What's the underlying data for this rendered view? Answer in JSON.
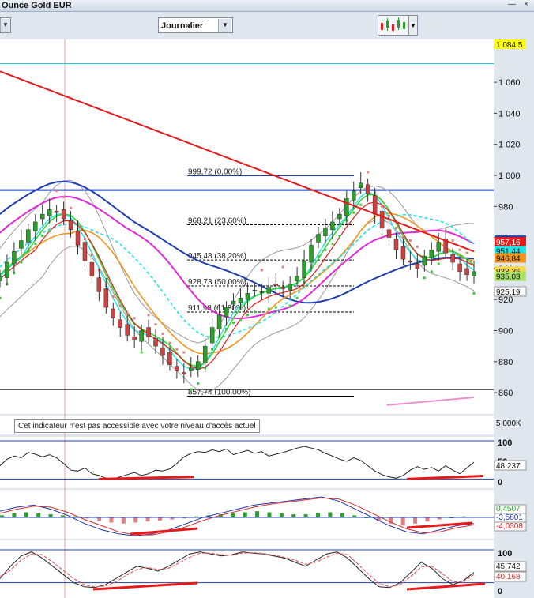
{
  "window": {
    "title": "Ounce Gold EUR",
    "minimize": "—",
    "close": "×"
  },
  "toolbar": {
    "period_label": "Journalier",
    "left_arrow": "▼",
    "period_arrow": "▼",
    "tool_arrow": "▼"
  },
  "notice": "Cet indicateur n'est pas accessible avec votre niveau d'accès actuel",
  "colors": {
    "background": "#ffffff",
    "resistance": "#e8191a",
    "ma_long": "#1f3fb0",
    "ma_mid": "#e02ad8",
    "ma_short": "#f3941d",
    "bollinger": "#9a9a9a",
    "sar": "#3ec83e",
    "fib": "#000000"
  },
  "chart_data": [
    {
      "type": "candlestick",
      "title": "Ounce Gold EUR",
      "period": "Journalier",
      "y_axis_ticks": [
        1060,
        1040,
        1020,
        1000,
        980,
        960,
        940,
        920,
        900,
        880,
        860
      ],
      "y_axis_tick_labels": [
        "1 060",
        "1 040",
        "1 020",
        "1 000",
        "980",
        "960",
        "940",
        "920",
        "900",
        "880",
        "860"
      ],
      "ylim": [
        852,
        1092
      ],
      "last_price_label": "938,36",
      "price_labels": [
        {
          "text": "1 084,5",
          "value": 1084.5,
          "color": "#ffff00"
        },
        {
          "text": "958,22",
          "value": 958.2,
          "color": "#1f3fb0"
        },
        {
          "text": "957,16",
          "value": 957.2,
          "color": "#e8191a"
        },
        {
          "text": "951,44",
          "value": 951.4,
          "color": "#22e3e3"
        },
        {
          "text": "946,84",
          "value": 946.8,
          "color": "#f3941d"
        },
        {
          "text": "938,36",
          "value": 938.4,
          "color": "#f7d94c"
        },
        {
          "text": "935,03",
          "value": 935.0,
          "color": "#a8e26a"
        },
        {
          "text": "925,19",
          "value": 925.2,
          "color": "#ffffff"
        }
      ],
      "fibonacci": [
        {
          "label": "999,72 (0,00%)",
          "value": 999.72
        },
        {
          "label": "968,21 (23,60%)",
          "value": 968.21
        },
        {
          "label": "945,48 (38,20%)",
          "value": 945.48
        },
        {
          "label": "928,73 (50,00%)",
          "value": 928.73
        },
        {
          "label": "911,98 (61,80%)",
          "value": 911.98
        },
        {
          "label": "857,74 (100,00%)",
          "value": 857.74
        }
      ],
      "horizontal_lines": [
        {
          "value": 1072
        },
        {
          "value": 990.5
        },
        {
          "value": 862
        }
      ],
      "trendlines": [
        {
          "name": "resistance",
          "from": [
            0,
            1067
          ],
          "to": [
            147,
            951
          ]
        },
        {
          "name": "lower-support",
          "from": [
            120,
            852
          ],
          "to": [
            147,
            857
          ]
        }
      ],
      "close": [
        935,
        944,
        951,
        958,
        965,
        970,
        975,
        978,
        976,
        972,
        965,
        955,
        945,
        935,
        925,
        915,
        908,
        902,
        897,
        894,
        900,
        896,
        890,
        884,
        878,
        874,
        872,
        876,
        880,
        890,
        902,
        910,
        915,
        919,
        921,
        924,
        926,
        925,
        928,
        929,
        927,
        930,
        935,
        945,
        955,
        962,
        966,
        970,
        975,
        985,
        990,
        995,
        988,
        975,
        966,
        960,
        952,
        946,
        944,
        940,
        948,
        952,
        957,
        950,
        944,
        938,
        936,
        938
      ]
    },
    {
      "type": "line",
      "indicator": "oscillator",
      "y_axis_tick_labels": [
        "100",
        "50",
        "0"
      ],
      "ylim": [
        0,
        100
      ],
      "value_label": "48,237",
      "values": [
        40,
        55,
        62,
        58,
        70,
        66,
        60,
        65,
        58,
        45,
        30,
        28,
        35,
        22,
        18,
        12,
        10,
        15,
        20,
        25,
        18,
        22,
        30,
        28,
        33,
        45,
        60,
        68,
        72,
        70,
        76,
        72,
        78,
        65,
        70,
        75,
        68,
        72,
        62,
        66,
        70,
        75,
        80,
        84,
        80,
        76,
        68,
        62,
        55,
        50,
        58,
        52,
        40,
        28,
        20,
        15,
        12,
        18,
        30,
        38,
        32,
        36,
        28,
        40,
        30,
        22,
        35,
        48
      ]
    },
    {
      "type": "bar",
      "indicator": "MACD",
      "value_labels": [
        "0,4507",
        "-3,5801",
        "-4,0308"
      ],
      "histogram": [
        1,
        2,
        2.5,
        2,
        1.5,
        1,
        0.5,
        -0.5,
        -1.5,
        -2.5,
        -3,
        -2.5,
        -2,
        -1.5,
        -1,
        -0.5,
        0.5,
        1,
        1.5,
        2,
        2.5,
        3,
        2.5,
        2,
        1.5,
        1.5,
        2,
        2.5,
        2,
        1,
        0,
        -1.5,
        -3,
        -4,
        -3,
        -2,
        -1,
        0,
        0.5
      ],
      "macd": [
        3,
        5,
        6,
        4,
        1,
        -3,
        -6,
        -8,
        -9,
        -8,
        -6,
        -3,
        0,
        2,
        4,
        6,
        7,
        8,
        9,
        10,
        8,
        4,
        0,
        -4,
        -7,
        -8,
        -6,
        -4,
        -3
      ],
      "signal": [
        2,
        4,
        5.5,
        5,
        2.5,
        -1,
        -4,
        -7,
        -8.5,
        -8.5,
        -7,
        -4.5,
        -1.5,
        1,
        3,
        5,
        6.5,
        7.5,
        8.5,
        9.5,
        9,
        6,
        2,
        -2,
        -5.5,
        -7.5,
        -7,
        -5,
        -3.6
      ]
    },
    {
      "type": "line",
      "indicator": "stochastic",
      "y_axis_tick_labels": [
        "100",
        "50",
        "0"
      ],
      "ylim": [
        0,
        100
      ],
      "value_labels": [
        "45,742",
        "40,168"
      ],
      "k": [
        30,
        60,
        85,
        95,
        80,
        60,
        40,
        20,
        10,
        8,
        15,
        30,
        45,
        60,
        55,
        48,
        60,
        75,
        90,
        95,
        90,
        85,
        88,
        95,
        92,
        90,
        85,
        80,
        70,
        60,
        75,
        90,
        95,
        80,
        55,
        30,
        10,
        8,
        20,
        45,
        70,
        55,
        30,
        15,
        25,
        45
      ],
      "d": [
        35,
        50,
        75,
        90,
        88,
        70,
        50,
        30,
        15,
        10,
        12,
        22,
        38,
        52,
        57,
        52,
        55,
        68,
        82,
        92,
        92,
        88,
        87,
        92,
        93,
        91,
        87,
        82,
        75,
        65,
        70,
        82,
        92,
        88,
        65,
        40,
        18,
        10,
        15,
        35,
        58,
        60,
        42,
        22,
        22,
        40
      ]
    }
  ]
}
